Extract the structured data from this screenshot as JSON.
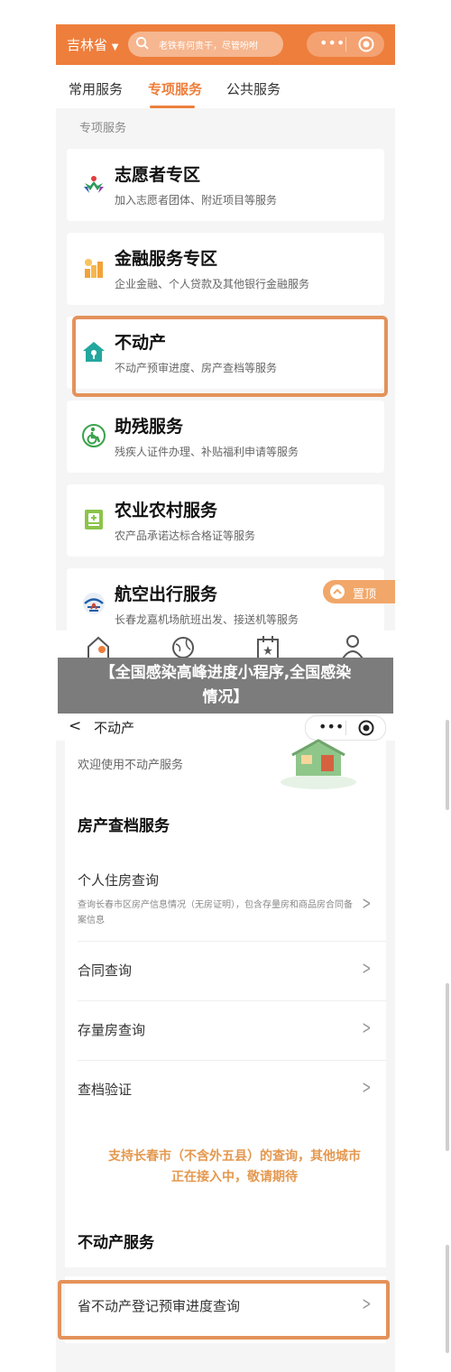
{
  "shot1": {
    "province": "吉林省",
    "province_caret": "▼",
    "search_placeholder": "老铁有何贵干，尽管吩咐",
    "capsule_dots": "•••",
    "tabs": [
      {
        "label": "常用服务"
      },
      {
        "label": "专项服务"
      },
      {
        "label": "公共服务"
      }
    ],
    "section_label": "专项服务",
    "cards": [
      {
        "title": "志愿者专区",
        "desc": "加入志愿者团体、附近项目等服务",
        "icon": "volunteer-icon",
        "color": "#2e9a5a"
      },
      {
        "title": "金融服务专区",
        "desc": "企业金融、个人贷款及其他银行金融服务",
        "icon": "finance-icon",
        "color": "#f2a23a"
      },
      {
        "title": "不动产",
        "desc": "不动产预审进度、房产查档等服务",
        "icon": "house-icon",
        "color": "#23a79e"
      },
      {
        "title": "助残服务",
        "desc": "残疾人证件办理、补贴福利申请等服务",
        "icon": "disability-icon",
        "color": "#3aa24a"
      },
      {
        "title": "农业农村服务",
        "desc": "农产品承诺达标合格证等服务",
        "icon": "agriculture-icon",
        "color": "#8cc44a"
      },
      {
        "title": "航空出行服务",
        "desc": "长春龙嘉机场航班出发、接送机等服务",
        "icon": "airport-icon",
        "color": "#1f5ea8"
      }
    ],
    "to_top_label": "置顶",
    "accent": "#ee7e3c"
  },
  "banner": {
    "line1": "【全国感染高峰进度小程序,全国感染",
    "line2": "情况】"
  },
  "shot2": {
    "back_glyph": "<",
    "title": "不动产",
    "capsule_dots": "•••",
    "welcome": "欢迎使用不动产服务",
    "section1_title": "房产查档服务",
    "rows": [
      {
        "title": "个人住房查询",
        "desc": "查询长春市区房产信息情况（无房证明），包含存量房和商品房合同备案信息"
      },
      {
        "title": "合同查询"
      },
      {
        "title": "存量房查询"
      },
      {
        "title": "查档验证"
      }
    ],
    "notice_line1": "支持长春市（不含外五县）的查询，其他城市",
    "notice_line2": "正在接入中，敬请期待",
    "section2_title": "不动产服务",
    "bottom_row": "省不动产登记预审进度查询",
    "chevron": ">"
  }
}
